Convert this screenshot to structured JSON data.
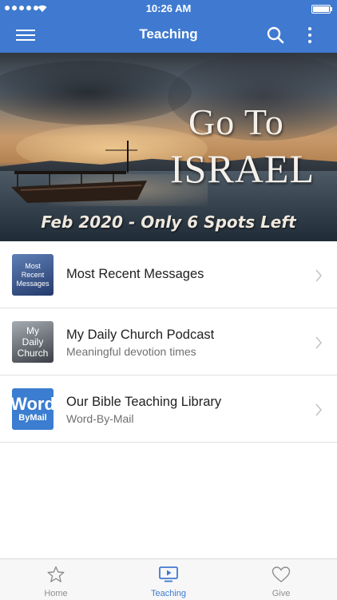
{
  "status_bar": {
    "time": "10:26 AM"
  },
  "navbar": {
    "title": "Teaching"
  },
  "banner": {
    "headline_line1": "Go To",
    "headline_line2": "ISRAEL",
    "tagline": "Feb 2020 - Only 6 Spots Left"
  },
  "list": {
    "items": [
      {
        "thumb_lines": [
          "Most",
          "Recent",
          "Messages"
        ],
        "title": "Most Recent Messages",
        "subtitle": ""
      },
      {
        "thumb_lines": [
          "My",
          "Daily",
          "Church"
        ],
        "title": "My Daily Church Podcast",
        "subtitle": "Meaningful devotion times"
      },
      {
        "thumb_lines": [
          "Word",
          "ByMail"
        ],
        "title": "Our Bible Teaching Library",
        "subtitle": "Word-By-Mail"
      }
    ]
  },
  "tabbar": {
    "tabs": [
      {
        "label": "Home",
        "icon": "star-icon"
      },
      {
        "label": "Teaching",
        "icon": "tv-play-icon"
      },
      {
        "label": "Give",
        "icon": "heart-icon"
      }
    ],
    "active": "Teaching"
  },
  "colors": {
    "brand": "#3f7ad0",
    "text": "#1f1f1f",
    "subtext": "#6f6f6f"
  }
}
